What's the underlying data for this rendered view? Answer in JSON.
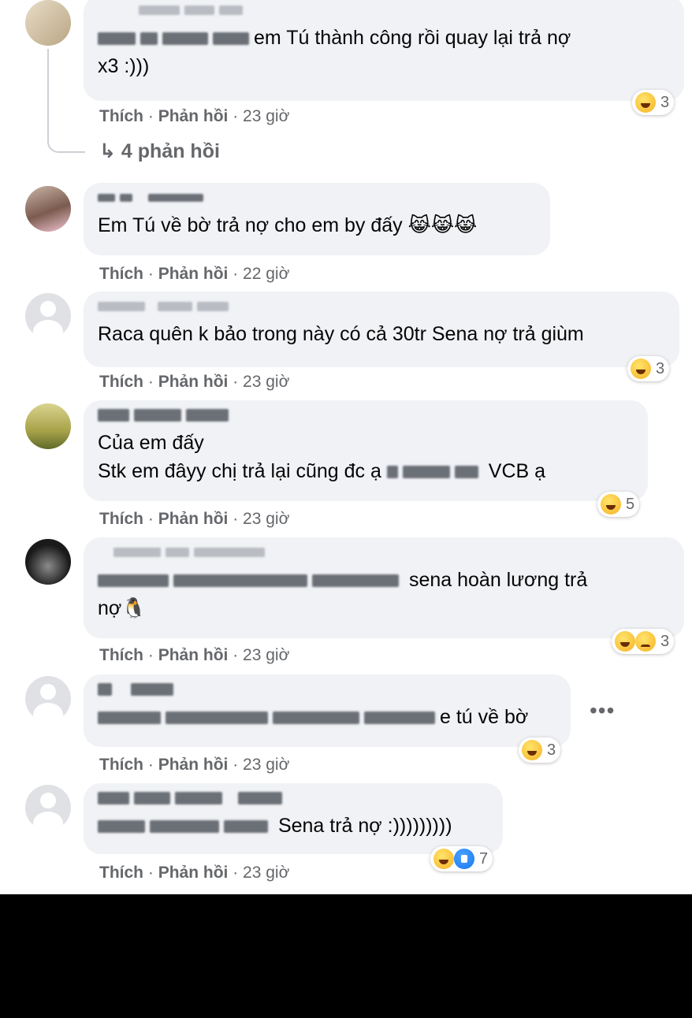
{
  "comments": [
    {
      "text": "em Tú thành công rồi quay lại trả nợ\nx3 :)))",
      "like": "Thích",
      "reply": "Phản hồi",
      "time": "23 giờ",
      "reactions": "3",
      "replies": "4 phản hồi"
    },
    {
      "text": "Em Tú về bờ trả nợ cho em by đấy 😹😹😹",
      "like": "Thích",
      "reply": "Phản hồi",
      "time": "22 giờ"
    },
    {
      "text": "Raca quên k bảo trong này có cả 30tr Sena nợ trả giùm",
      "like": "Thích",
      "reply": "Phản hồi",
      "time": "23 giờ",
      "reactions": "3"
    },
    {
      "text": "Của em đấy\nStk em đâyy chị trả lại cũng đc ạ",
      "text_end": "VCB ạ",
      "like": "Thích",
      "reply": "Phản hồi",
      "time": "23 giờ",
      "reactions": "5"
    },
    {
      "text": "sena hoàn lương trả\nnợ🐧",
      "like": "Thích",
      "reply": "Phản hồi",
      "time": "23 giờ",
      "reactions": "3"
    },
    {
      "text": "e tú về bờ",
      "like": "Thích",
      "reply": "Phản hồi",
      "time": "23 giờ",
      "reactions": "3",
      "more": "•••"
    },
    {
      "text": "Sena trả nợ :)))))))))",
      "like": "Thích",
      "reply": "Phản hồi",
      "time": "23 giờ",
      "reactions": "7"
    }
  ],
  "separator": "·",
  "icons": [
    "haha-icon",
    "sad-icon",
    "like-icon",
    "reply-arrow-icon",
    "more-options-icon",
    "default-avatar-icon"
  ],
  "colors": {
    "bubble": "#f0f2f5",
    "meta": "#65676b",
    "text": "#050505",
    "haha": "#f7b125",
    "like": "#1877f2"
  }
}
